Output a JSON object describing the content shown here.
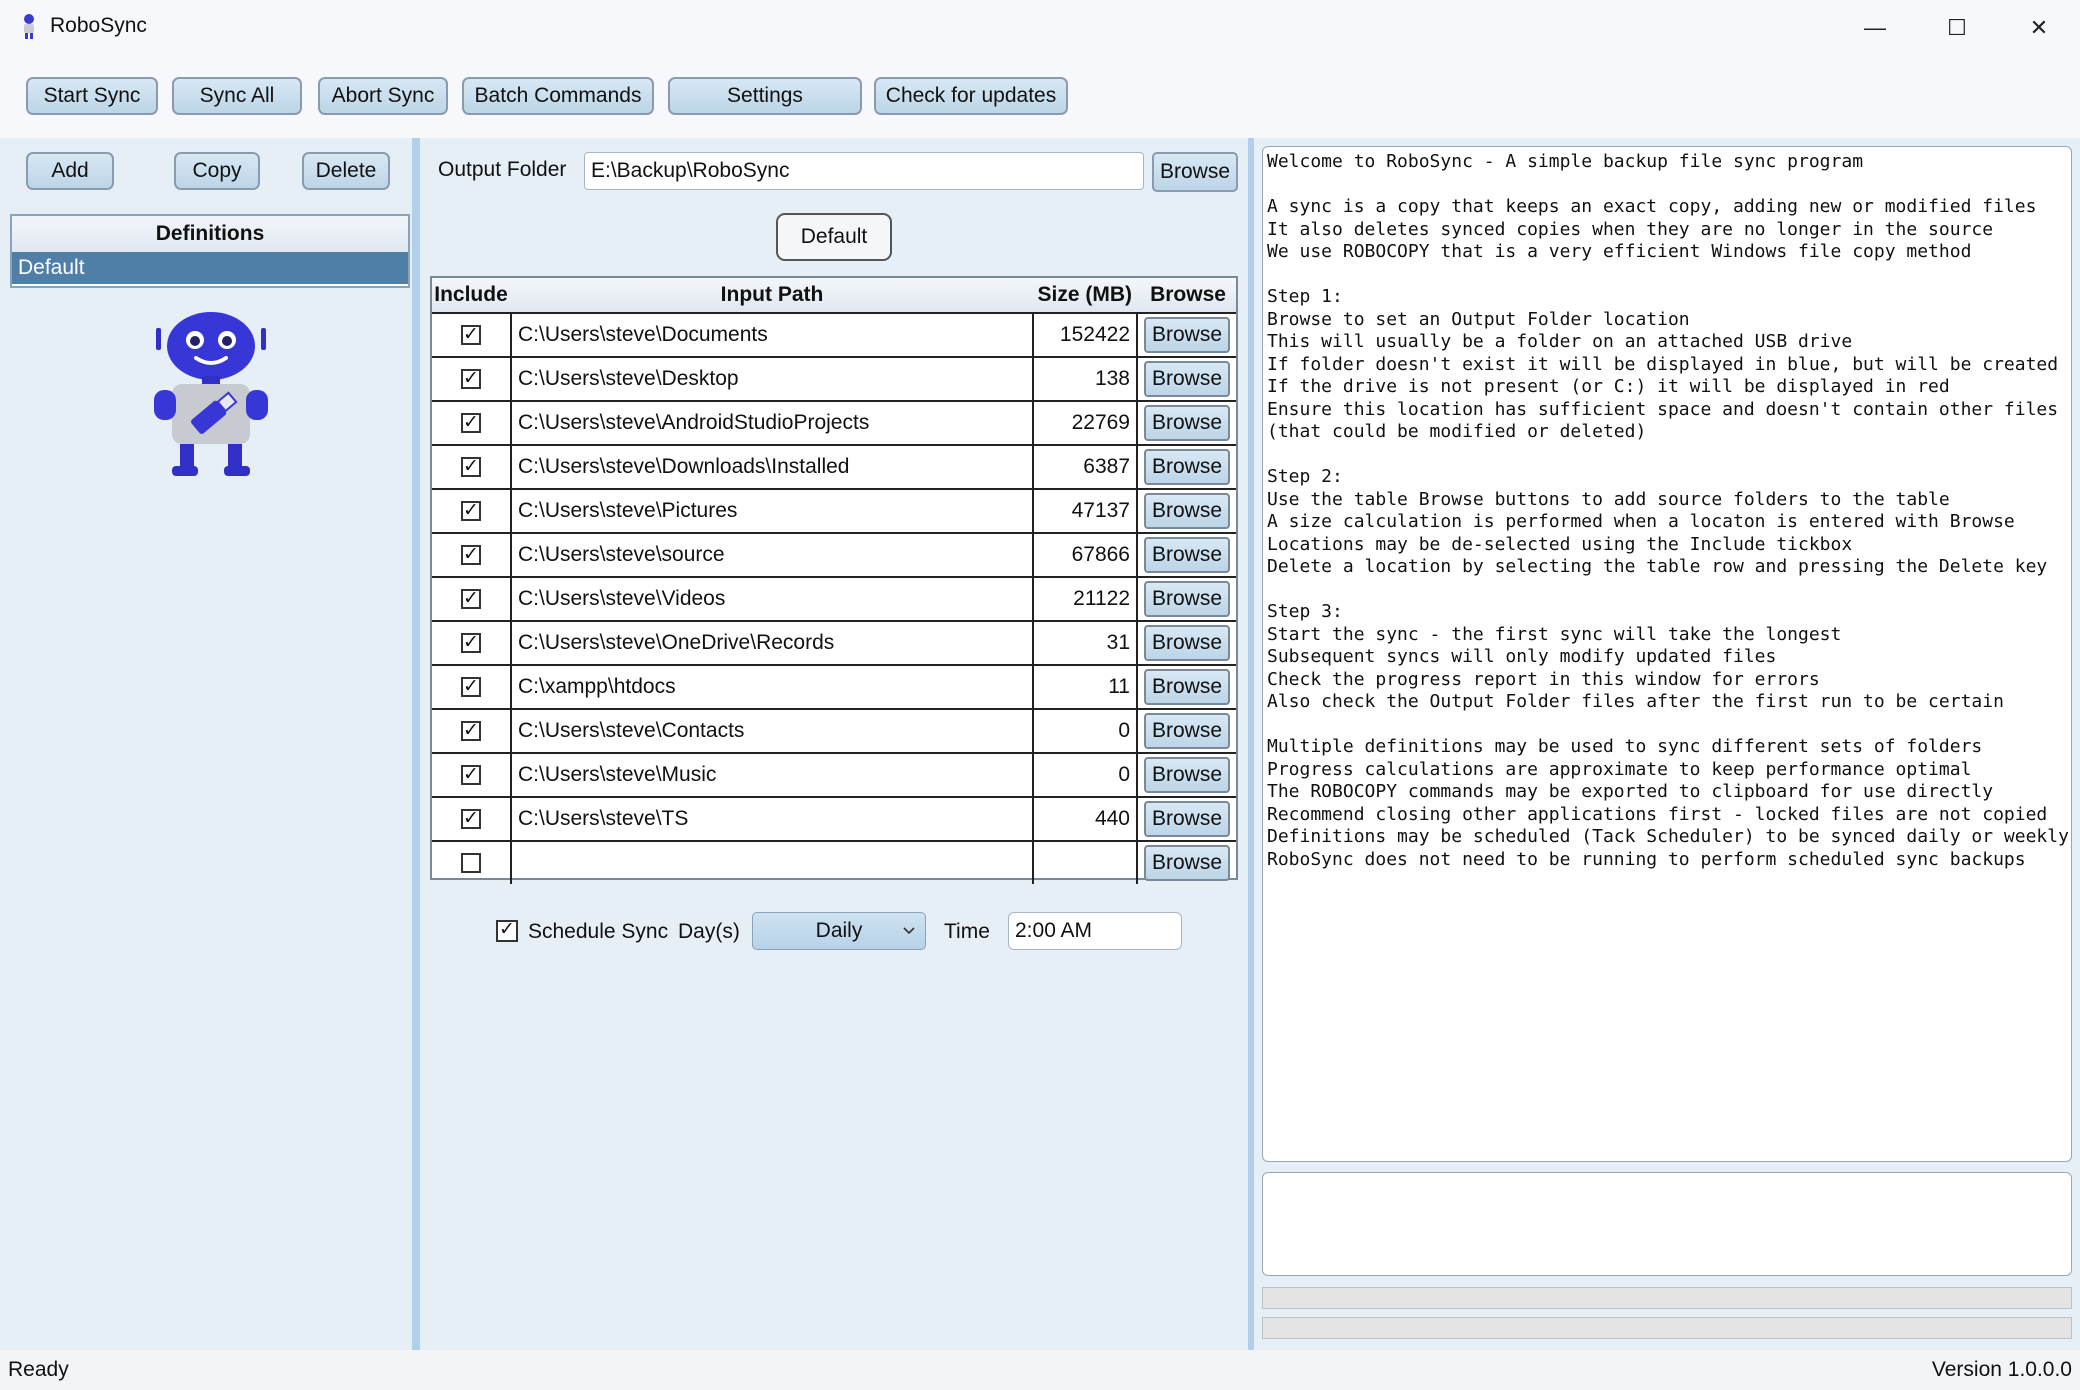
{
  "window": {
    "title": "RoboSync",
    "minimize": "—",
    "maximize": "☐",
    "close": "✕"
  },
  "toolbar": {
    "start_sync": "Start Sync",
    "sync_all": "Sync All",
    "abort_sync": "Abort Sync",
    "batch_commands": "Batch Commands",
    "settings": "Settings",
    "check_updates": "Check for updates"
  },
  "left": {
    "add": "Add",
    "copy": "Copy",
    "delete": "Delete",
    "definitions_header": "Definitions",
    "definitions": [
      "Default"
    ],
    "mascot_icon": "robot-usb-icon"
  },
  "output": {
    "label": "Output Folder",
    "value": "E:\\Backup\\RoboSync",
    "browse": "Browse",
    "default_button": "Default"
  },
  "table": {
    "headers": {
      "include": "Include",
      "path": "Input Path",
      "size": "Size (MB)",
      "browse": "Browse"
    },
    "rows": [
      {
        "checked": true,
        "path": "C:\\Users\\steve\\Documents",
        "size": "152422",
        "browse": "Browse"
      },
      {
        "checked": true,
        "path": "C:\\Users\\steve\\Desktop",
        "size": "138",
        "browse": "Browse"
      },
      {
        "checked": true,
        "path": "C:\\Users\\steve\\AndroidStudioProjects",
        "size": "22769",
        "browse": "Browse"
      },
      {
        "checked": true,
        "path": "C:\\Users\\steve\\Downloads\\Installed",
        "size": "6387",
        "browse": "Browse"
      },
      {
        "checked": true,
        "path": "C:\\Users\\steve\\Pictures",
        "size": "47137",
        "browse": "Browse"
      },
      {
        "checked": true,
        "path": "C:\\Users\\steve\\source",
        "size": "67866",
        "browse": "Browse"
      },
      {
        "checked": true,
        "path": "C:\\Users\\steve\\Videos",
        "size": "21122",
        "browse": "Browse"
      },
      {
        "checked": true,
        "path": "C:\\Users\\steve\\OneDrive\\Records",
        "size": "31",
        "browse": "Browse"
      },
      {
        "checked": true,
        "path": "C:\\xampp\\htdocs",
        "size": "11",
        "browse": "Browse"
      },
      {
        "checked": true,
        "path": "C:\\Users\\steve\\Contacts",
        "size": "0",
        "browse": "Browse"
      },
      {
        "checked": true,
        "path": "C:\\Users\\steve\\Music",
        "size": "0",
        "browse": "Browse"
      },
      {
        "checked": true,
        "path": "C:\\Users\\steve\\TS",
        "size": "440",
        "browse": "Browse"
      },
      {
        "checked": false,
        "path": "",
        "size": "",
        "browse": "Browse"
      }
    ]
  },
  "schedule": {
    "checked": true,
    "label": "Schedule Sync",
    "days_label": "Day(s)",
    "days_value": "Daily",
    "time_label": "Time",
    "time_value": "2:00 AM"
  },
  "log": {
    "text": "Welcome to RoboSync - A simple backup file sync program\n\nA sync is a copy that keeps an exact copy, adding new or modified files\nIt also deletes synced copies when they are no longer in the source\nWe use ROBOCOPY that is a very efficient Windows file copy method\n\nStep 1:\nBrowse to set an Output Folder location\nThis will usually be a folder on an attached USB drive\nIf folder doesn't exist it will be displayed in blue, but will be created\nIf the drive is not present (or C:) it will be displayed in red\nEnsure this location has sufficient space and doesn't contain other files\n(that could be modified or deleted)\n\nStep 2:\nUse the table Browse buttons to add source folders to the table\nA size calculation is performed when a locaton is entered with Browse\nLocations may be de-selected using the Include tickbox\nDelete a location by selecting the table row and pressing the Delete key\n\nStep 3:\nStart the sync - the first sync will take the longest\nSubsequent syncs will only modify updated files\nCheck the progress report in this window for errors\nAlso check the Output Folder files after the first run to be certain\n\nMultiple definitions may be used to sync different sets of folders\nProgress calculations are approximate to keep performance optimal\nThe ROBOCOPY commands may be exported to clipboard for use directly\nRecommend closing other applications first - locked files are not copied\nDefinitions may be scheduled (Tack Scheduler) to be synced daily or weekly\nRoboSync does not need to be running to perform scheduled sync backups",
    "secondary_text": "",
    "progress1": 0,
    "progress2": 0
  },
  "status": {
    "text": "Ready",
    "version": "Version 1.0.0.0"
  }
}
